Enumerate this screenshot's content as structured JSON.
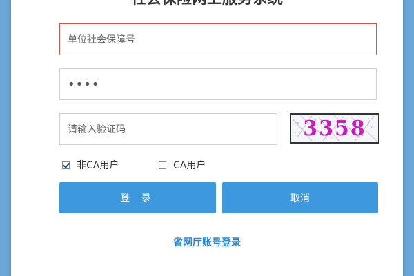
{
  "page": {
    "title": "社会保险网上服务系统"
  },
  "form": {
    "org_id_placeholder": "单位社会保障号",
    "password_value": "••••",
    "captcha_placeholder": "请输入验证码",
    "captcha_code": "3358"
  },
  "options": {
    "non_ca_label": "非CA用户",
    "non_ca_checked": true,
    "ca_label": "CA用户",
    "ca_checked": false
  },
  "buttons": {
    "login_label": "登 录",
    "cancel_label": "取消"
  },
  "links": {
    "provincial_login": "省网厅账号登录"
  },
  "colors": {
    "accent": "#3d98dd",
    "error_border": "#d9534f",
    "captcha_text": "#c21dbb"
  }
}
